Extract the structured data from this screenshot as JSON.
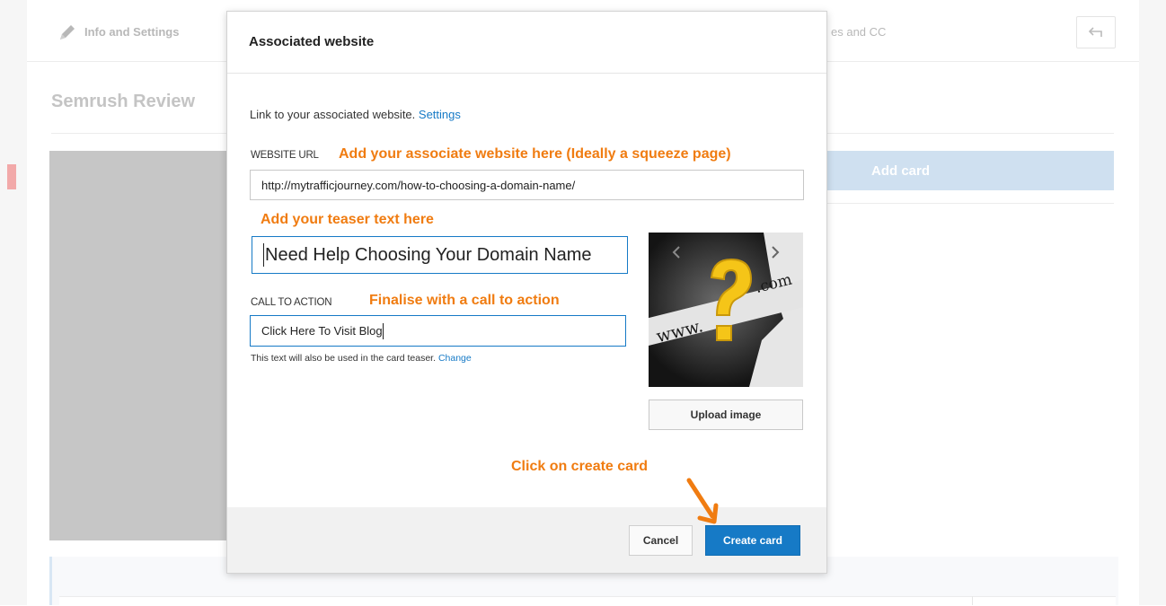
{
  "background": {
    "tab_info": "Info and Settings",
    "tab_subtitles": "es and CC",
    "video_title": "Semrush Review ",
    "add_card": "Add card"
  },
  "modal": {
    "title": "Associated website",
    "intro_text": "Link to your associated website.",
    "intro_link": "Settings",
    "website_url_label": "WEBSITE URL",
    "website_url_value": "http://mytrafficjourney.com/how-to-choosing-a-domain-name/",
    "teaser_value": "Need Help Choosing Your Domain Name",
    "cta_label": "CALL TO ACTION",
    "cta_value": "Click Here To Visit Blog",
    "helper_text": "This text will also be used in the card teaser.",
    "helper_link": "Change",
    "upload_label": "Upload image",
    "cancel_label": "Cancel",
    "create_label": "Create card"
  },
  "annotations": {
    "url": "Add your associate website here (Ideally a squeeze page)",
    "teaser": "Add your teaser text here",
    "cta": "Finalise with a call to action",
    "create": "Click on create card"
  },
  "thumbnail": {
    "text_www": "www.",
    "text_com": ".com"
  },
  "colors": {
    "accent": "#167ac6",
    "annotation": "#f07c11"
  }
}
